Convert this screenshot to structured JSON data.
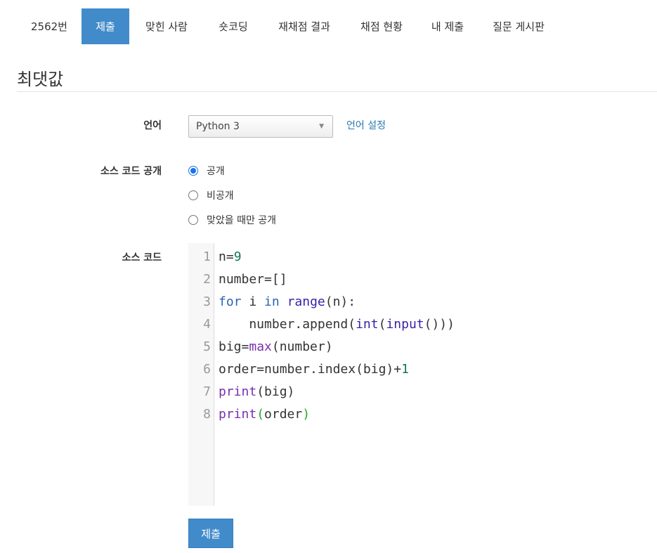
{
  "tabs": [
    {
      "label": "2562번",
      "active": false
    },
    {
      "label": "제출",
      "active": true
    },
    {
      "label": "맞힌 사람",
      "active": false
    },
    {
      "label": "숏코딩",
      "active": false
    },
    {
      "label": "재채점 결과",
      "active": false
    },
    {
      "label": "채점 현황",
      "active": false
    },
    {
      "label": "내 제출",
      "active": false
    },
    {
      "label": "질문 게시판",
      "active": false
    }
  ],
  "title": "최댓값",
  "form": {
    "language_label": "언어",
    "language_value": "Python 3",
    "language_settings_link": "언어 설정",
    "visibility_label": "소스 코드 공개",
    "visibility_options": [
      {
        "label": "공개",
        "checked": true
      },
      {
        "label": "비공개",
        "checked": false
      },
      {
        "label": "맞았을 때만 공개",
        "checked": false
      }
    ],
    "source_label": "소스 코드",
    "submit_label": "제출"
  },
  "code": {
    "line_numbers": [
      "1",
      "2",
      "3",
      "4",
      "5",
      "6",
      "7",
      "8"
    ],
    "lines": [
      [
        {
          "t": "n",
          "c": ""
        },
        {
          "t": "=",
          "c": "op"
        },
        {
          "t": "9",
          "c": "num"
        }
      ],
      [
        {
          "t": "number",
          "c": ""
        },
        {
          "t": "=[]",
          "c": "op"
        }
      ],
      [
        {
          "t": "for",
          "c": "kwb"
        },
        {
          "t": " i ",
          "c": ""
        },
        {
          "t": "in",
          "c": "kwb"
        },
        {
          "t": " ",
          "c": ""
        },
        {
          "t": "range",
          "c": "bi"
        },
        {
          "t": "(n):",
          "c": ""
        }
      ],
      [
        {
          "t": "    number.append(",
          "c": ""
        },
        {
          "t": "int",
          "c": "bi"
        },
        {
          "t": "(",
          "c": ""
        },
        {
          "t": "input",
          "c": "bi"
        },
        {
          "t": "()))",
          "c": ""
        }
      ],
      [
        {
          "t": "big",
          "c": ""
        },
        {
          "t": "=",
          "c": "op"
        },
        {
          "t": "max",
          "c": "kw"
        },
        {
          "t": "(number)",
          "c": ""
        }
      ],
      [
        {
          "t": "order",
          "c": ""
        },
        {
          "t": "=",
          "c": "op"
        },
        {
          "t": "number.index(big)",
          "c": ""
        },
        {
          "t": "+",
          "c": "op"
        },
        {
          "t": "1",
          "c": "num"
        }
      ],
      [
        {
          "t": "print",
          "c": "kw"
        },
        {
          "t": "(big)",
          "c": ""
        }
      ],
      [
        {
          "t": "print",
          "c": "kw"
        },
        {
          "t": "(",
          "c": "pg"
        },
        {
          "t": "order",
          "c": ""
        },
        {
          "t": ")",
          "c": "pg"
        }
      ]
    ]
  },
  "colors": {
    "accent": "#428bca",
    "link": "#2a7ab0",
    "radio_checked": "#1a73e8"
  }
}
